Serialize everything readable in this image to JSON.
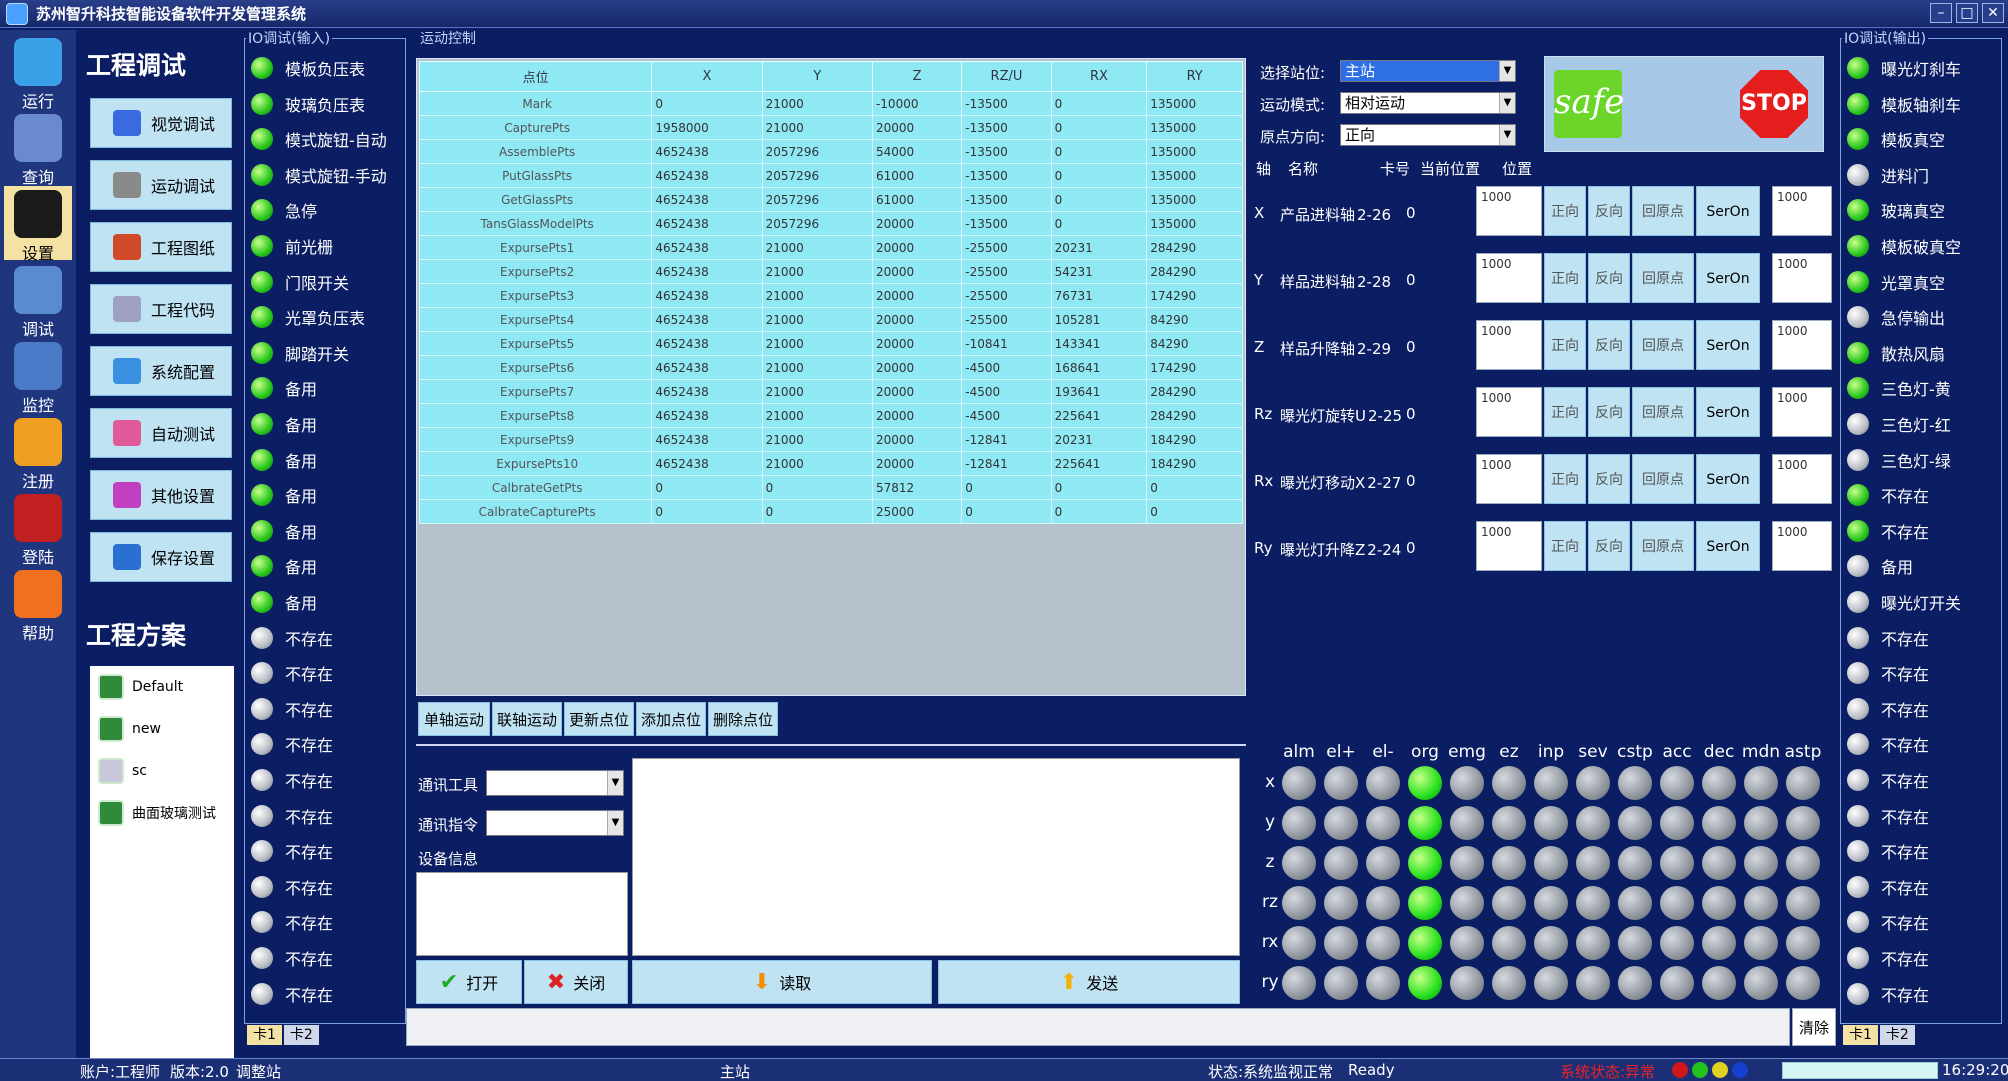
{
  "window": {
    "title": "苏州智升科技智能设备软件开发管理系统",
    "min": "–",
    "max": "□",
    "close": "✕"
  },
  "nav": [
    {
      "label": "运行",
      "icon": "monitor-icon"
    },
    {
      "label": "查询",
      "icon": "bar-chart-icon"
    },
    {
      "label": "设置",
      "icon": "gear-icon"
    },
    {
      "label": "调试",
      "icon": "spreadsheet-icon"
    },
    {
      "label": "监控",
      "icon": "computer-icon"
    },
    {
      "label": "注册",
      "icon": "key-icon"
    },
    {
      "label": "登陆",
      "icon": "login-icon"
    },
    {
      "label": "帮助",
      "icon": "help-icon"
    }
  ],
  "tools": {
    "title": "工程调试",
    "buttons": [
      "视觉调试",
      "运动调试",
      "工程图纸",
      "工程代码",
      "系统配置",
      "自动测试",
      "其他设置",
      "保存设置"
    ]
  },
  "projects": {
    "title": "工程方案",
    "items": [
      "Default",
      "new",
      "sc",
      "曲面玻璃测试"
    ]
  },
  "io_in": {
    "legend": "IO调试(输入)",
    "items": [
      {
        "label": "模板负压表",
        "on": true
      },
      {
        "label": "玻璃负压表",
        "on": true
      },
      {
        "label": "模式旋钮-自动",
        "on": true
      },
      {
        "label": "模式旋钮-手动",
        "on": true
      },
      {
        "label": "急停",
        "on": true
      },
      {
        "label": "前光栅",
        "on": true
      },
      {
        "label": "门限开关",
        "on": true
      },
      {
        "label": "光罩负压表",
        "on": true
      },
      {
        "label": "脚踏开关",
        "on": true
      },
      {
        "label": "备用",
        "on": true
      },
      {
        "label": "备用",
        "on": true
      },
      {
        "label": "备用",
        "on": true
      },
      {
        "label": "备用",
        "on": true
      },
      {
        "label": "备用",
        "on": true
      },
      {
        "label": "备用",
        "on": true
      },
      {
        "label": "备用",
        "on": true
      },
      {
        "label": "不存在",
        "on": false
      },
      {
        "label": "不存在",
        "on": false
      },
      {
        "label": "不存在",
        "on": false
      },
      {
        "label": "不存在",
        "on": false
      },
      {
        "label": "不存在",
        "on": false
      },
      {
        "label": "不存在",
        "on": false
      },
      {
        "label": "不存在",
        "on": false
      },
      {
        "label": "不存在",
        "on": false
      },
      {
        "label": "不存在",
        "on": false
      },
      {
        "label": "不存在",
        "on": false
      },
      {
        "label": "不存在",
        "on": false
      }
    ],
    "tabs": [
      "卡1",
      "卡2"
    ]
  },
  "io_out": {
    "legend": "IO调试(输出)",
    "items": [
      {
        "label": "曝光灯刹车",
        "on": true
      },
      {
        "label": "模板轴刹车",
        "on": true
      },
      {
        "label": "模板真空",
        "on": true
      },
      {
        "label": "进料门",
        "on": false
      },
      {
        "label": "玻璃真空",
        "on": true
      },
      {
        "label": "模板破真空",
        "on": true
      },
      {
        "label": "光罩真空",
        "on": true
      },
      {
        "label": "急停输出",
        "on": false
      },
      {
        "label": "散热风扇",
        "on": true
      },
      {
        "label": "三色灯-黄",
        "on": true
      },
      {
        "label": "三色灯-红",
        "on": false
      },
      {
        "label": "三色灯-绿",
        "on": false
      },
      {
        "label": "不存在",
        "on": true
      },
      {
        "label": "不存在",
        "on": true
      },
      {
        "label": "备用",
        "on": false
      },
      {
        "label": "曝光灯开关",
        "on": false
      },
      {
        "label": "不存在",
        "on": false
      },
      {
        "label": "不存在",
        "on": false
      },
      {
        "label": "不存在",
        "on": false
      },
      {
        "label": "不存在",
        "on": false
      },
      {
        "label": "不存在",
        "on": false
      },
      {
        "label": "不存在",
        "on": false
      },
      {
        "label": "不存在",
        "on": false
      },
      {
        "label": "不存在",
        "on": false
      },
      {
        "label": "不存在",
        "on": false
      },
      {
        "label": "不存在",
        "on": false
      },
      {
        "label": "不存在",
        "on": false
      }
    ],
    "tabs": [
      "卡1",
      "卡2"
    ]
  },
  "motion": {
    "legend": "运动控制",
    "columns": [
      "点位",
      "X",
      "Y",
      "Z",
      "RZ/U",
      "RX",
      "RY"
    ],
    "rows": [
      [
        "Mark",
        "0",
        "21000",
        "-10000",
        "-13500",
        "0",
        "135000"
      ],
      [
        "CapturePts",
        "1958000",
        "21000",
        "20000",
        "-13500",
        "0",
        "135000"
      ],
      [
        "AssemblePts",
        "4652438",
        "2057296",
        "54000",
        "-13500",
        "0",
        "135000"
      ],
      [
        "PutGlassPts",
        "4652438",
        "2057296",
        "61000",
        "-13500",
        "0",
        "135000"
      ],
      [
        "GetGlassPts",
        "4652438",
        "2057296",
        "61000",
        "-13500",
        "0",
        "135000"
      ],
      [
        "TansGlassModelPts",
        "4652438",
        "2057296",
        "20000",
        "-13500",
        "0",
        "135000"
      ],
      [
        "ExpursePts1",
        "4652438",
        "21000",
        "20000",
        "-25500",
        "20231",
        "284290"
      ],
      [
        "ExpursePts2",
        "4652438",
        "21000",
        "20000",
        "-25500",
        "54231",
        "284290"
      ],
      [
        "ExpursePts3",
        "4652438",
        "21000",
        "20000",
        "-25500",
        "76731",
        "174290"
      ],
      [
        "ExpursePts4",
        "4652438",
        "21000",
        "20000",
        "-25500",
        "105281",
        "84290"
      ],
      [
        "ExpursePts5",
        "4652438",
        "21000",
        "20000",
        "-10841",
        "143341",
        "84290"
      ],
      [
        "ExpursePts6",
        "4652438",
        "21000",
        "20000",
        "-4500",
        "168641",
        "174290"
      ],
      [
        "ExpursePts7",
        "4652438",
        "21000",
        "20000",
        "-4500",
        "193641",
        "284290"
      ],
      [
        "ExpursePts8",
        "4652438",
        "21000",
        "20000",
        "-4500",
        "225641",
        "284290"
      ],
      [
        "ExpursePts9",
        "4652438",
        "21000",
        "20000",
        "-12841",
        "20231",
        "184290"
      ],
      [
        "ExpursePts10",
        "4652438",
        "21000",
        "20000",
        "-12841",
        "225641",
        "184290"
      ],
      [
        "CalbrateGetPts",
        "0",
        "0",
        "57812",
        "0",
        "0",
        "0"
      ],
      [
        "CalbrateCapturePts",
        "0",
        "0",
        "25000",
        "0",
        "0",
        "0"
      ]
    ],
    "actions": [
      "单轴运动",
      "联轴运动",
      "更新点位",
      "添加点位",
      "删除点位"
    ],
    "comm_tool_label": "通讯工具",
    "comm_cmd_label": "通讯指令",
    "device_info_label": "设备信息",
    "open": "打开",
    "close": "关闭",
    "read": "读取",
    "send": "发送"
  },
  "axes": {
    "station_label": "选择站位:",
    "station": "主站",
    "mode_label": "运动模式:",
    "mode": "相对运动",
    "dir_label": "原点方向:",
    "dir": "正向",
    "safe": "safe",
    "stop": "STOP",
    "head": {
      "axis": "轴",
      "name": "名称",
      "card": "卡号",
      "cur": "当前位置",
      "pos": "位置"
    },
    "rows": [
      {
        "axis": "X",
        "name": "产品进料轴",
        "card": "2-26",
        "pos": "0",
        "speed": "1000",
        "step": "1000"
      },
      {
        "axis": "Y",
        "name": "样品进料轴",
        "card": "2-28",
        "pos": "0",
        "speed": "1000",
        "step": "1000"
      },
      {
        "axis": "Z",
        "name": "样品升降轴",
        "card": "2-29",
        "pos": "0",
        "speed": "1000",
        "step": "1000"
      },
      {
        "axis": "Rz",
        "name": "曝光灯旋转U",
        "card": "2-25",
        "pos": "0",
        "speed": "1000",
        "step": "1000"
      },
      {
        "axis": "Rx",
        "name": "曝光灯移动X",
        "card": "2-27",
        "pos": "0",
        "speed": "1000",
        "step": "1000"
      },
      {
        "axis": "Ry",
        "name": "曝光灯升降Z",
        "card": "2-24",
        "pos": "0",
        "speed": "1000",
        "step": "1000"
      }
    ],
    "buttons": {
      "fwd": "正向",
      "rev": "反向",
      "home": "回原点",
      "servo": "SerOn"
    }
  },
  "status_grid": {
    "columns": [
      "alm",
      "el+",
      "el-",
      "org",
      "emg",
      "ez",
      "inp",
      "sev",
      "cstp",
      "acc",
      "dec",
      "mdn",
      "astp"
    ],
    "rows": [
      "x",
      "y",
      "z",
      "rz",
      "rx",
      "ry"
    ],
    "on_col": 3
  },
  "clear": "清除",
  "statusbar": {
    "account": "账户:工程师",
    "version": "版本:2.0",
    "mode": "调整站",
    "station": "主站",
    "sys": "状态:系统监视正常",
    "ready": "Ready",
    "alarm": "系统状态:异常",
    "time": "16:29:20"
  }
}
